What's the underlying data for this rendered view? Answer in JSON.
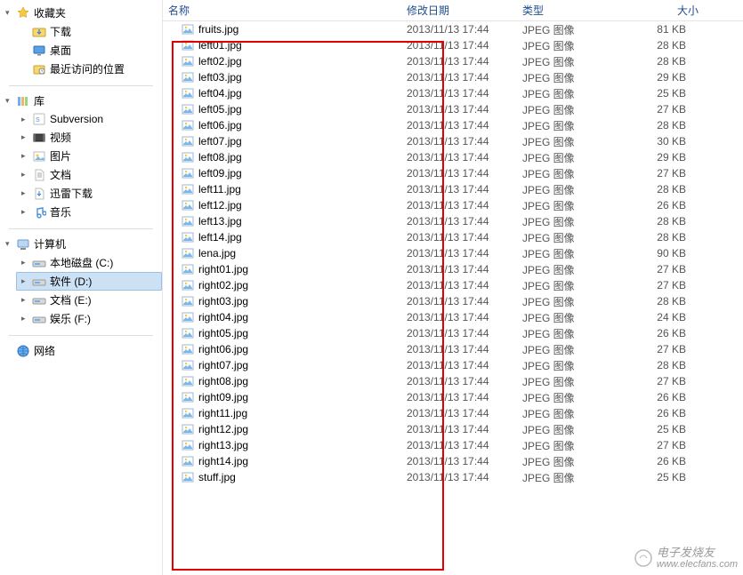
{
  "sidebar": {
    "favorites": {
      "label": "收藏夹",
      "items": [
        {
          "label": "下载"
        },
        {
          "label": "桌面"
        },
        {
          "label": "最近访问的位置"
        }
      ]
    },
    "library": {
      "label": "库",
      "items": [
        {
          "label": "Subversion"
        },
        {
          "label": "视频"
        },
        {
          "label": "图片"
        },
        {
          "label": "文档"
        },
        {
          "label": "迅雷下载"
        },
        {
          "label": "音乐"
        }
      ]
    },
    "computer": {
      "label": "计算机",
      "items": [
        {
          "label": "本地磁盘 (C:)"
        },
        {
          "label": "软件 (D:)"
        },
        {
          "label": "文档 (E:)"
        },
        {
          "label": "娱乐 (F:)"
        }
      ]
    },
    "network": {
      "label": "网络"
    }
  },
  "columns": {
    "name": "名称",
    "date": "修改日期",
    "type": "类型",
    "size": "大小"
  },
  "common_date": "2013/11/13 17:44",
  "common_type": "JPEG 图像",
  "files": [
    {
      "name": "fruits.jpg",
      "size": "81 KB",
      "boxed": false
    },
    {
      "name": "left01.jpg",
      "size": "28 KB",
      "boxed": true
    },
    {
      "name": "left02.jpg",
      "size": "28 KB",
      "boxed": true
    },
    {
      "name": "left03.jpg",
      "size": "29 KB",
      "boxed": true
    },
    {
      "name": "left04.jpg",
      "size": "25 KB",
      "boxed": true
    },
    {
      "name": "left05.jpg",
      "size": "27 KB",
      "boxed": true
    },
    {
      "name": "left06.jpg",
      "size": "28 KB",
      "boxed": true
    },
    {
      "name": "left07.jpg",
      "size": "30 KB",
      "boxed": true
    },
    {
      "name": "left08.jpg",
      "size": "29 KB",
      "boxed": true
    },
    {
      "name": "left09.jpg",
      "size": "27 KB",
      "boxed": true
    },
    {
      "name": "left11.jpg",
      "size": "28 KB",
      "boxed": true
    },
    {
      "name": "left12.jpg",
      "size": "26 KB",
      "boxed": true
    },
    {
      "name": "left13.jpg",
      "size": "28 KB",
      "boxed": true
    },
    {
      "name": "left14.jpg",
      "size": "28 KB",
      "boxed": true
    },
    {
      "name": "lena.jpg",
      "size": "90 KB",
      "boxed": false
    },
    {
      "name": "right01.jpg",
      "size": "27 KB",
      "boxed": true
    },
    {
      "name": "right02.jpg",
      "size": "27 KB",
      "boxed": true
    },
    {
      "name": "right03.jpg",
      "size": "28 KB",
      "boxed": true
    },
    {
      "name": "right04.jpg",
      "size": "24 KB",
      "boxed": true
    },
    {
      "name": "right05.jpg",
      "size": "26 KB",
      "boxed": true
    },
    {
      "name": "right06.jpg",
      "size": "27 KB",
      "boxed": true
    },
    {
      "name": "right07.jpg",
      "size": "28 KB",
      "boxed": true
    },
    {
      "name": "right08.jpg",
      "size": "27 KB",
      "boxed": true
    },
    {
      "name": "right09.jpg",
      "size": "26 KB",
      "boxed": true
    },
    {
      "name": "right11.jpg",
      "size": "26 KB",
      "boxed": true
    },
    {
      "name": "right12.jpg",
      "size": "25 KB",
      "boxed": true
    },
    {
      "name": "right13.jpg",
      "size": "27 KB",
      "boxed": true
    },
    {
      "name": "right14.jpg",
      "size": "26 KB",
      "boxed": true
    },
    {
      "name": "stuff.jpg",
      "size": "25 KB",
      "boxed": false
    }
  ],
  "watermark": {
    "text1": "电子发烧友",
    "text2": "www.elecfans.com"
  }
}
